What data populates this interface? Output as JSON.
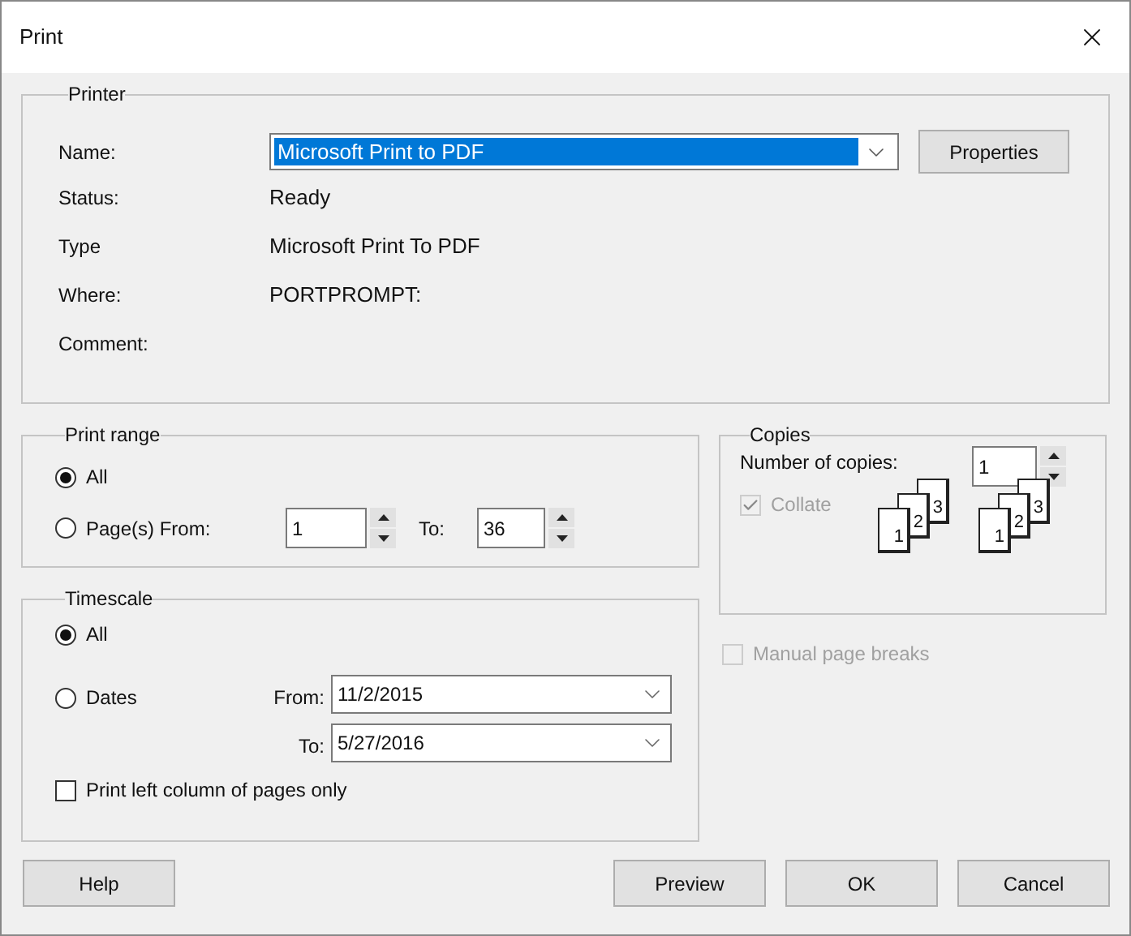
{
  "window": {
    "title": "Print"
  },
  "printer": {
    "legend": "Printer",
    "name_label": "Name:",
    "name_value": "Microsoft Print to PDF",
    "properties_button": "Properties",
    "info": [
      {
        "label": "Status:",
        "value": "Ready"
      },
      {
        "label": "Type",
        "value": "Microsoft Print To PDF"
      },
      {
        "label": "Where:",
        "value": "PORTPROMPT:"
      },
      {
        "label": "Comment:"
      }
    ]
  },
  "print_range": {
    "legend": "Print range",
    "options": [
      {
        "label": "All",
        "selected": true
      },
      {
        "label": "Page(s) From:",
        "selected": false
      }
    ],
    "from": "1",
    "to_label": "To:",
    "to": "36"
  },
  "timescale": {
    "legend": "Timescale",
    "options": [
      {
        "label": "All",
        "selected": true
      },
      {
        "label": "Dates",
        "selected": false
      }
    ],
    "from_label": "From:",
    "from": "11/2/2015",
    "to_label": "To:",
    "to": "5/27/2016",
    "left_column": {
      "label": "Print left column of pages only",
      "checked": false
    }
  },
  "copies": {
    "legend": "Copies",
    "number_label": "Number of copies:",
    "number": "1",
    "collate": {
      "label": "Collate",
      "checked": true,
      "disabled": true
    },
    "page_stacks": [
      [
        "1",
        "2",
        "3"
      ],
      [
        "1",
        "2",
        "3"
      ]
    ]
  },
  "manual_page_breaks": {
    "label": "Manual page breaks",
    "checked": false,
    "disabled": true
  },
  "buttons": [
    "Help",
    "Preview",
    "OK",
    "Cancel"
  ]
}
